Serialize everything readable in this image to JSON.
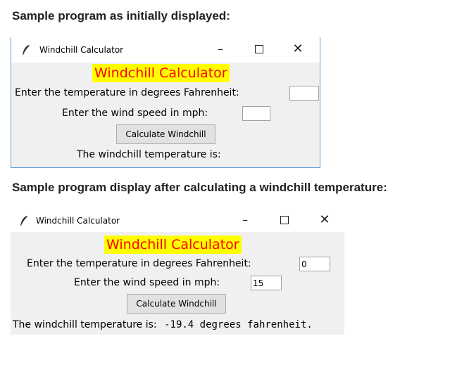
{
  "headings": {
    "initial": "Sample program as initially displayed:",
    "after": "Sample program display after calculating a windchill temperature:"
  },
  "window_before": {
    "title": "Windchill Calculator",
    "banner": "Windchill Calculator",
    "temp_label": "Enter the temperature in degrees Fahrenheit:",
    "temp_value": "",
    "wind_label": "Enter the wind speed in mph:",
    "wind_value": "",
    "button_label": "Calculate Windchill",
    "result_label": "The windchill temperature is:",
    "result_value": ""
  },
  "window_after": {
    "title": "Windchill Calculator",
    "banner": "Windchill Calculator",
    "temp_label": "Enter the temperature in degrees Fahrenheit:",
    "temp_value": "0",
    "wind_label": "Enter the wind speed in mph:",
    "wind_value": "15",
    "button_label": "Calculate Windchill",
    "result_label": "The windchill temperature is:",
    "result_value": "-19.4 degrees fahrenheit."
  },
  "colors": {
    "banner_bg": "#ffff00",
    "banner_text": "#ff0000",
    "window_bg": "#f0f0f0",
    "window_border": "#5b9bd5"
  },
  "icons": {
    "app": "feather-icon",
    "minimize": "minimize-icon",
    "maximize": "maximize-icon",
    "close": "close-icon"
  }
}
